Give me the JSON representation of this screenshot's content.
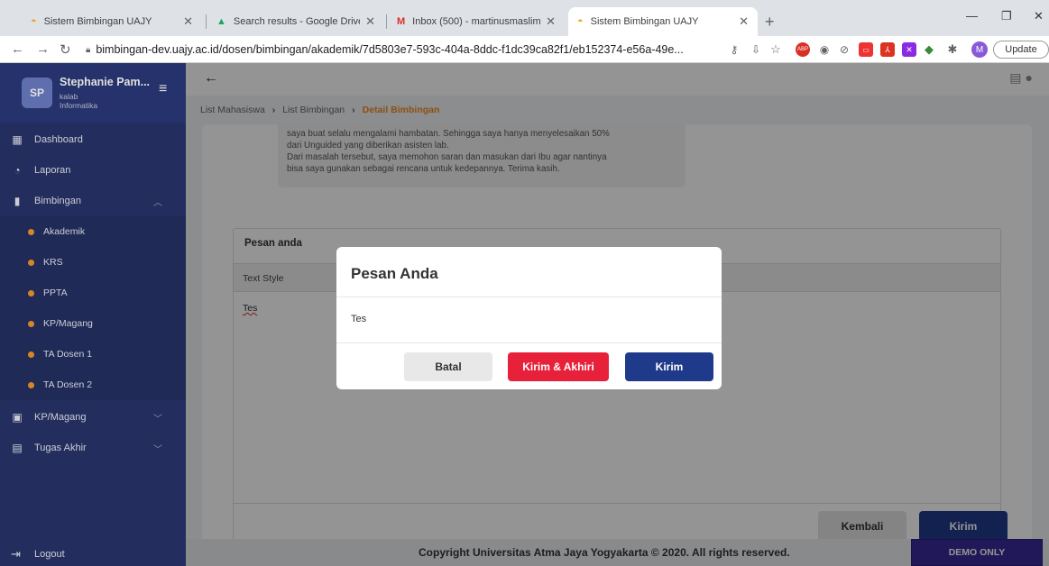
{
  "browser": {
    "tabs": [
      {
        "title": "Sistem Bimbingan UAJY"
      },
      {
        "title": "Search results - Google Drive"
      },
      {
        "title": "Inbox (500) - martinusmaslim12"
      },
      {
        "title": "Sistem Bimbingan UAJY"
      }
    ],
    "url": "bimbingan-dev.uajy.ac.id/dosen/bimbingan/akademik/7d5803e7-593c-404a-8ddc-f1dc39ca82f1/eb152374-e56a-49e...",
    "update_label": "Update",
    "avatar_letter": "M",
    "abp_label": "ABP"
  },
  "sidebar": {
    "initials": "SP",
    "name": "Stephanie Pam...",
    "role_line1": "kalab",
    "role_line2": "Informatika",
    "menu": [
      {
        "label": "Dashboard"
      },
      {
        "label": "Laporan"
      },
      {
        "label": "Bimbingan"
      }
    ],
    "submenu": [
      {
        "label": "Akademik"
      },
      {
        "label": "KRS"
      },
      {
        "label": "PPTA"
      },
      {
        "label": "KP/Magang"
      },
      {
        "label": "TA Dosen 1"
      },
      {
        "label": "TA Dosen 2"
      }
    ],
    "menu2": [
      {
        "label": "KP/Magang"
      },
      {
        "label": "Tugas Akhir"
      }
    ],
    "logout": "Logout"
  },
  "breadcrumb": {
    "item1": "List Mahasiswa",
    "item2": "List Bimbingan",
    "current": "Detail Bimbingan"
  },
  "message": {
    "line1": "saya buat selalu mengalami hambatan. Sehingga saya hanya menyelesaikan 50%",
    "line2": "dari Unguided yang diberikan asisten lab.",
    "line3": "Dari masalah tersebut, saya memohon saran dan masukan dari Ibu agar nantinya",
    "line4": "bisa saya gunakan sebagai rencana untuk kedepannya. Terima kasih."
  },
  "panel": {
    "title": "Pesan anda",
    "toolbar": "Text Style",
    "content": "Tes",
    "back_label": "Kembali",
    "send_label": "Kirim"
  },
  "modal": {
    "title": "Pesan Anda",
    "body": "Tes",
    "cancel_label": "Batal",
    "send_finish_label": "Kirim & Akhiri",
    "send_label": "Kirim"
  },
  "footer": {
    "copyright": "Copyright Universitas Atma Jaya Yogyakarta © 2020. All rights reserved.",
    "demo": "DEMO ONLY"
  }
}
